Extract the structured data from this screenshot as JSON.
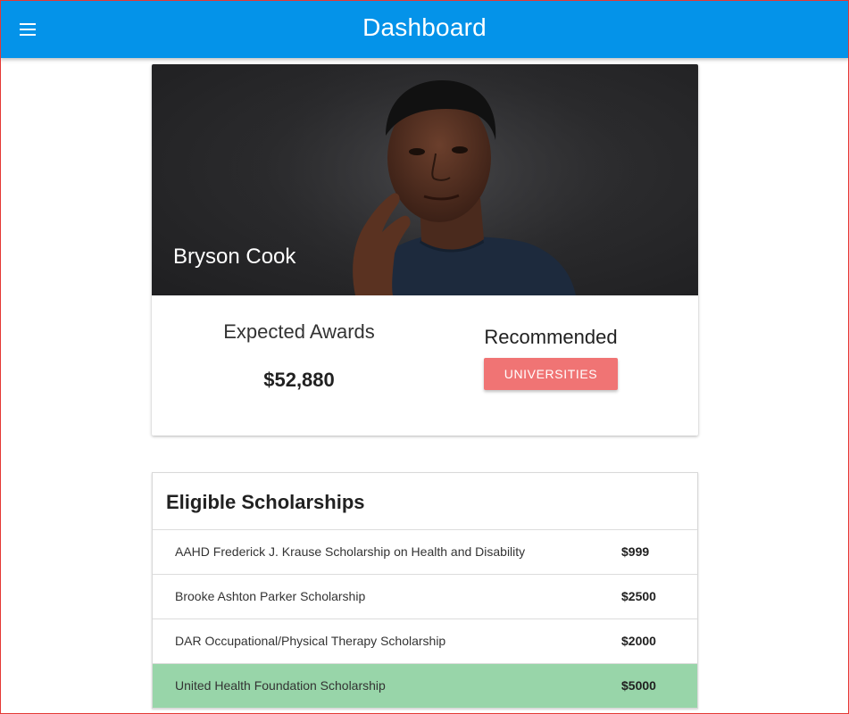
{
  "header": {
    "title": "Dashboard",
    "menu_icon": "menu-icon"
  },
  "profile": {
    "name": "Bryson Cook",
    "expected_awards_label": "Expected Awards",
    "expected_awards_value": "$52,880",
    "recommended_label": "Recommended",
    "universities_button": "UNIVERSITIES"
  },
  "scholarships": {
    "title": "Eligible Scholarships",
    "items": [
      {
        "name": "AAHD Frederick J. Krause Scholarship on Health and Disability",
        "amount": "$999"
      },
      {
        "name": "Brooke Ashton Parker Scholarship",
        "amount": "$2500"
      },
      {
        "name": "DAR Occupational/Physical Therapy Scholarship",
        "amount": "$2000"
      },
      {
        "name": "United Health Foundation Scholarship",
        "amount": "$5000",
        "highlighted": true
      }
    ]
  },
  "colors": {
    "appbar": "#0493e9",
    "button": "#f07474",
    "highlight_row": "#98d5a9"
  }
}
